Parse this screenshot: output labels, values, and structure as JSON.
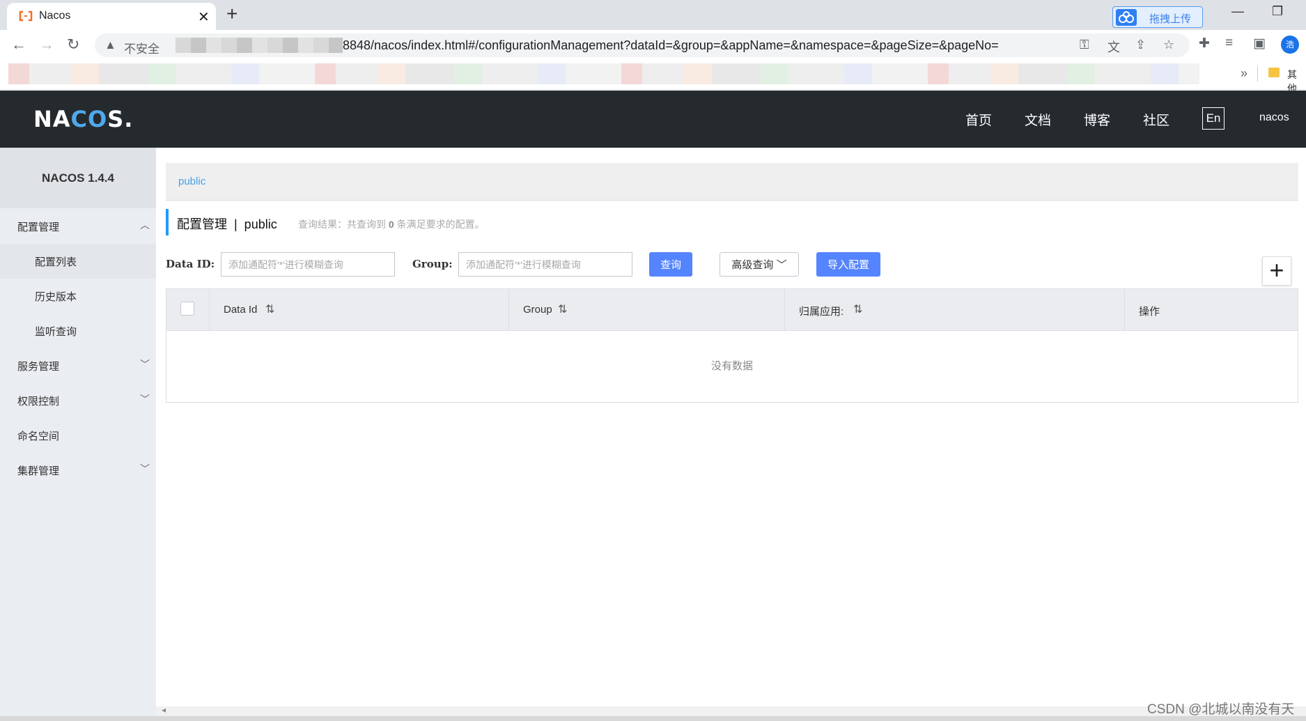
{
  "browser": {
    "tab_title": "Nacos",
    "tab_close": "✕",
    "new_tab": "+",
    "upload_button": "拖拽上传",
    "insecure_label": "不安全",
    "url": "8848/nacos/index.html#/configurationManagement?dataId=&group=&appName=&namespace=&pageSize=&pageNo=",
    "profile_initial": "浩",
    "bookmarks_more": "»",
    "bookmarks_other": "其他"
  },
  "header": {
    "logo_left": "NA",
    "logo_mid": "CO",
    "logo_right": "S.",
    "nav": [
      "首页",
      "文档",
      "博客",
      "社区"
    ],
    "lang": "En",
    "user": "nacos"
  },
  "sidebar": {
    "version": "NACOS 1.4.4",
    "items": [
      {
        "label": "配置管理",
        "chevron": "︿"
      },
      {
        "label": "配置列表"
      },
      {
        "label": "历史版本"
      },
      {
        "label": "监听查询"
      },
      {
        "label": "服务管理",
        "chevron": "﹀"
      },
      {
        "label": "权限控制",
        "chevron": "﹀"
      },
      {
        "label": "命名空间"
      },
      {
        "label": "集群管理",
        "chevron": "﹀"
      }
    ]
  },
  "main": {
    "namespace": "public",
    "title": "配置管理  |  public",
    "result_prefix": "查询结果：共查询到 ",
    "result_count": "0",
    "result_suffix": " 条满足要求的配置。",
    "filters": {
      "data_id_label": "Data ID:",
      "data_id_placeholder": "添加通配符'*'进行模糊查询",
      "group_label": "Group:",
      "group_placeholder": "添加通配符'*'进行模糊查询",
      "query_button": "查询",
      "advanced_button": "高级查询 ﹀",
      "import_button": "导入配置",
      "add_button": "+"
    },
    "table": {
      "columns": [
        "Data Id",
        "Group",
        "归属应用:",
        "操作"
      ],
      "sort_glyph": "⇅",
      "empty": "没有数据"
    }
  },
  "watermark": "CSDN @北城以南没有天"
}
